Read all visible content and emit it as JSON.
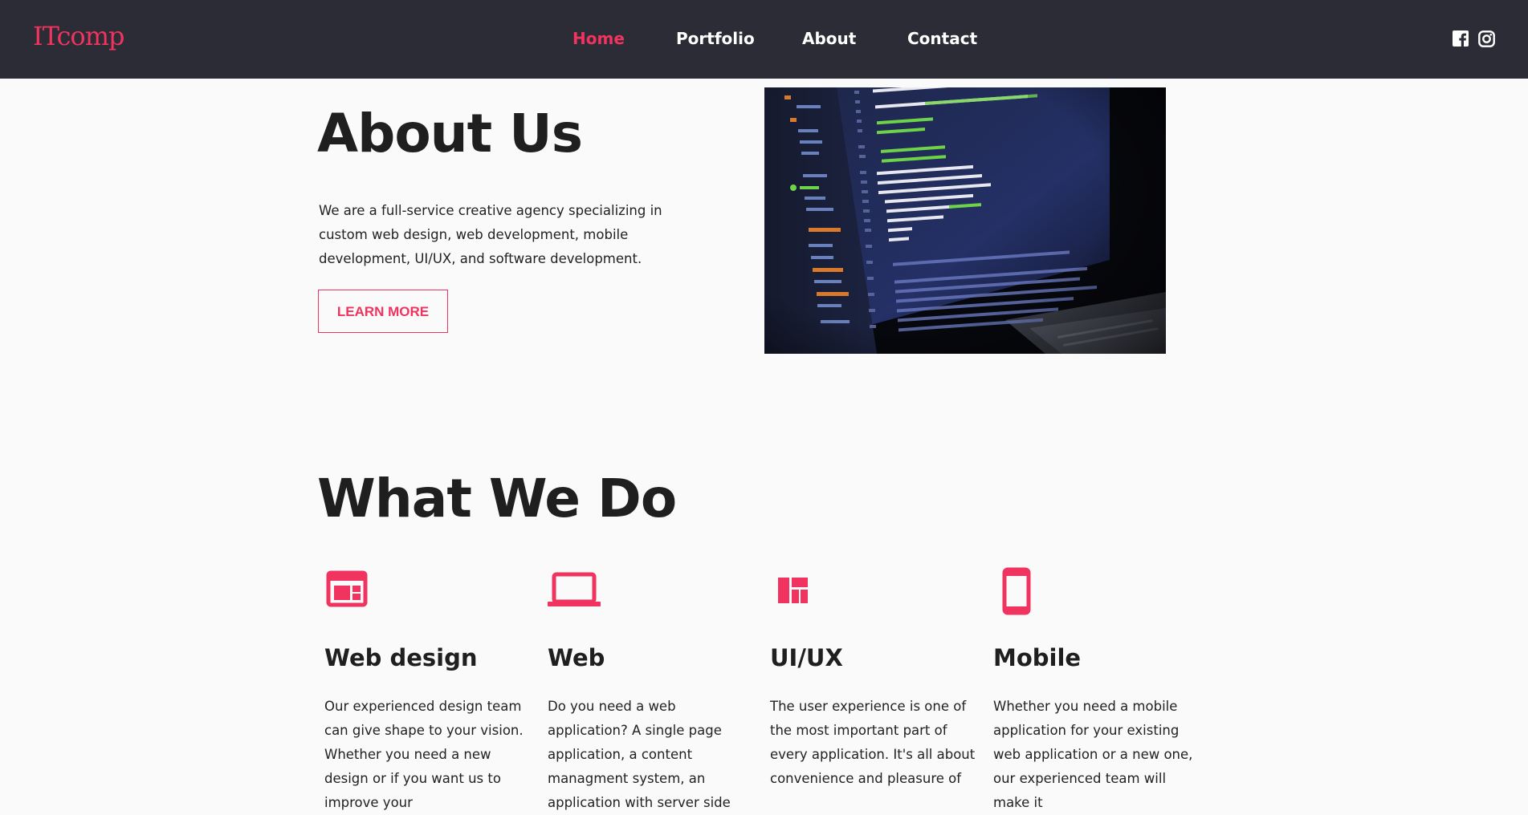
{
  "header": {
    "logo": "ITcomp",
    "nav": [
      {
        "label": "Home",
        "active": true
      },
      {
        "label": "Portfolio",
        "active": false
      },
      {
        "label": "About",
        "active": false
      },
      {
        "label": "Contact",
        "active": false
      }
    ],
    "social_icons": [
      "facebook-icon",
      "instagram-icon"
    ]
  },
  "about": {
    "title": "About Us",
    "text": "We are a full-service creative agency specializing in custom web design, web development, mobile development, UI/UX, and software development.",
    "button_label": "LEARN MORE",
    "image": "laptop-code-screen"
  },
  "what_we_do": {
    "title": "What We Do",
    "services": [
      {
        "icon": "web-design-icon",
        "title": "Web design",
        "text": "Our experienced design team can give shape to your vision. Whether you need a new design or if you want us to improve your"
      },
      {
        "icon": "laptop-icon",
        "title": "Web",
        "text": "Do you need a web application? A single page application, a content managment system, an application with server side"
      },
      {
        "icon": "dashboard-icon",
        "title": "UI/UX",
        "text": "The user experience is one of the most important part of every application. It's all about convenience and pleasure of"
      },
      {
        "icon": "smartphone-icon",
        "title": "Mobile",
        "text": "Whether you need a mobile application for your existing web application or a new one, our experienced team will make it"
      }
    ]
  },
  "colors": {
    "accent": "#f0335f",
    "header_bg": "#2b2c36",
    "page_bg": "#fafafa",
    "text": "#1f1f1f"
  }
}
